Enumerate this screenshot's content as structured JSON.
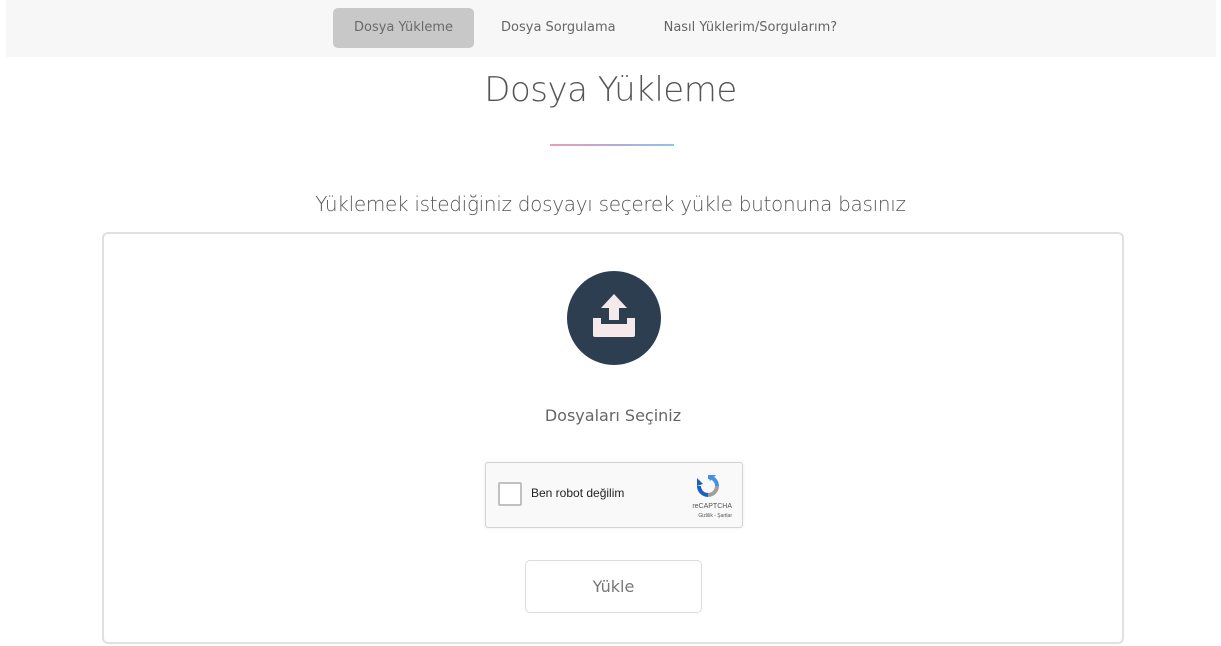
{
  "nav": {
    "items": [
      {
        "label": "Dosya Yükleme",
        "active": true
      },
      {
        "label": "Dosya Sorgulama",
        "active": false
      },
      {
        "label": "Nasıl Yüklerim/Sorgularım?",
        "active": false
      }
    ]
  },
  "main": {
    "title": "Dosya Yükleme",
    "subtitle": "Yüklemek istediğiniz dosyayı seçerek yükle butonuna basınız",
    "choose_files_label": "Dosyaları Seçiniz",
    "submit_label": "Yükle"
  },
  "recaptcha": {
    "label": "Ben robot değilim",
    "brand": "reCAPTCHA",
    "links": "Gizlilik - Şartlar"
  },
  "colors": {
    "icon_bg": "#2c3e50",
    "icon_fg": "#f5e9ea",
    "active_tab": "#c8c8c8"
  },
  "icons": {
    "upload": "upload-tray-icon",
    "recaptcha": "recaptcha-logo-icon"
  }
}
